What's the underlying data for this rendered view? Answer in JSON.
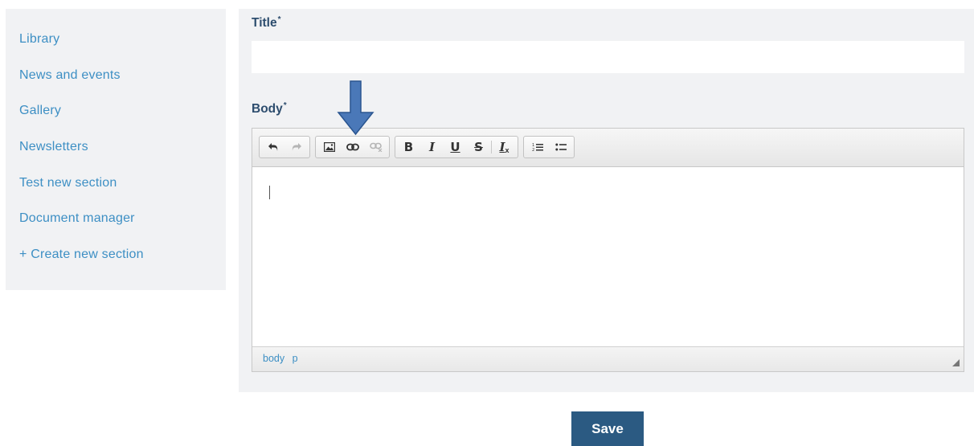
{
  "sidebar": {
    "items": [
      {
        "label": "Library"
      },
      {
        "label": "News and events"
      },
      {
        "label": "Gallery"
      },
      {
        "label": "Newsletters"
      },
      {
        "label": "Test new section"
      },
      {
        "label": "Document manager"
      },
      {
        "label": "+ Create new section"
      }
    ]
  },
  "form": {
    "title_label": "Title",
    "body_label": "Body",
    "required_marker": "*",
    "title_value": ""
  },
  "editor": {
    "toolbar": {
      "undo": "undo-icon",
      "redo": "redo-icon",
      "image": "image-icon",
      "link": "link-icon",
      "unlink": "unlink-icon",
      "bold_label": "B",
      "italic_label": "I",
      "underline_label": "U",
      "strike_label": "S",
      "clear_format_label": "I",
      "clear_format_sub": "x",
      "ordered_list": "ordered-list-icon",
      "bullet_list": "bullet-list-icon"
    },
    "status_path": [
      "body",
      "p"
    ]
  },
  "actions": {
    "save_label": "Save"
  },
  "colors": {
    "sidebar_link": "#3d8fc4",
    "label": "#2d4d6e",
    "panel_bg": "#f1f2f4",
    "save_bg": "#2b5a82",
    "annotation_arrow": "#4a78b8"
  }
}
